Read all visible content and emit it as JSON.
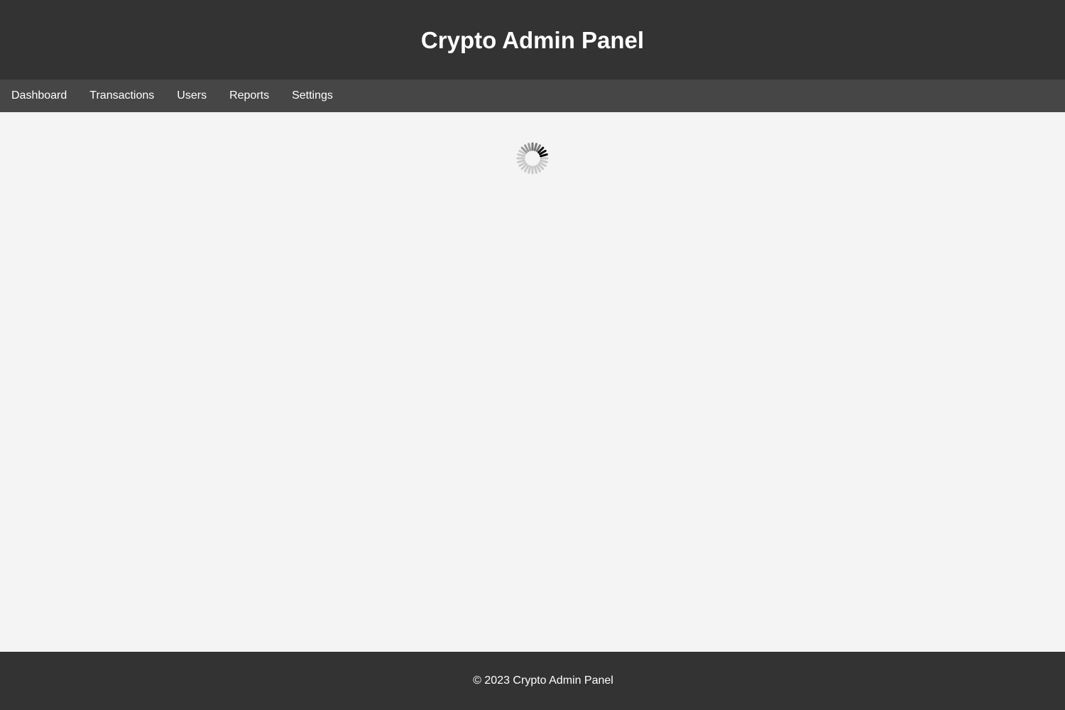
{
  "header": {
    "title": "Crypto Admin Panel"
  },
  "nav": {
    "items": [
      {
        "label": "Dashboard"
      },
      {
        "label": "Transactions"
      },
      {
        "label": "Users"
      },
      {
        "label": "Reports"
      },
      {
        "label": "Settings"
      }
    ]
  },
  "main": {
    "loading_icon": "spinner-icon"
  },
  "footer": {
    "text": "© 2023 Crypto Admin Panel"
  },
  "colors": {
    "header_bg": "#333333",
    "nav_bg": "#464646",
    "page_bg": "#f4f4f4",
    "footer_bg": "#333333",
    "text": "#ffffff"
  }
}
